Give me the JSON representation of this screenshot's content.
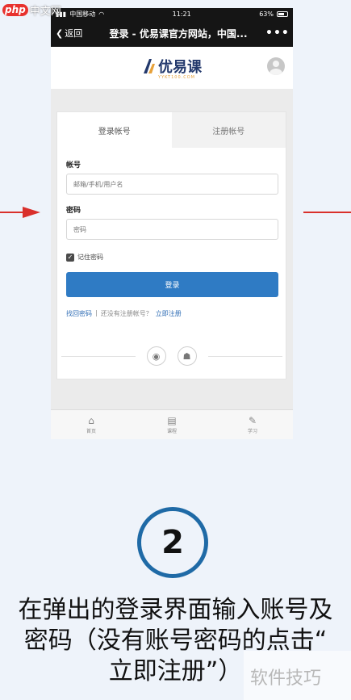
{
  "watermark": {
    "logo": "php",
    "text": "中文网"
  },
  "phone": {
    "status_bar": {
      "carrier": "中国移动",
      "time": "11:21",
      "battery": "63%"
    },
    "nav": {
      "back_label": "返回",
      "title": "登录 - 优易课官方网站，中国...",
      "more": "•••"
    },
    "site": {
      "logo_text": "优易课",
      "logo_sub": "YYKT100.COM"
    },
    "login_card": {
      "tabs": [
        {
          "label": "登录帐号"
        },
        {
          "label": "注册帐号"
        }
      ],
      "account_label": "帐号",
      "account_placeholder": "邮箱/手机/用户名",
      "password_label": "密码",
      "password_placeholder": "密码",
      "remember_label": "记住密码",
      "login_button": "登录",
      "forgot_link": "找回密码",
      "separator": "|",
      "no_account_text": "还没有注册帐号？",
      "register_link": "立即注册"
    },
    "social": {
      "weibo_icon": "weibo-icon",
      "qq_icon": "qq-icon"
    },
    "tab_bar": [
      {
        "label": "首页",
        "icon": "home-icon"
      },
      {
        "label": "课程",
        "icon": "book-icon"
      },
      {
        "label": "学习",
        "icon": "pencil-icon"
      }
    ]
  },
  "step": {
    "number": "2"
  },
  "caption": {
    "line1": "在弹出的登录界面输入账号及",
    "line2": "密码（没有账号密码的点击“",
    "line3": "立即注册”）"
  },
  "brand_watermark": "软件技巧",
  "colors": {
    "accent": "#2f7bc4",
    "step_ring": "#1f6aa6",
    "arrow": "#d9302b"
  }
}
